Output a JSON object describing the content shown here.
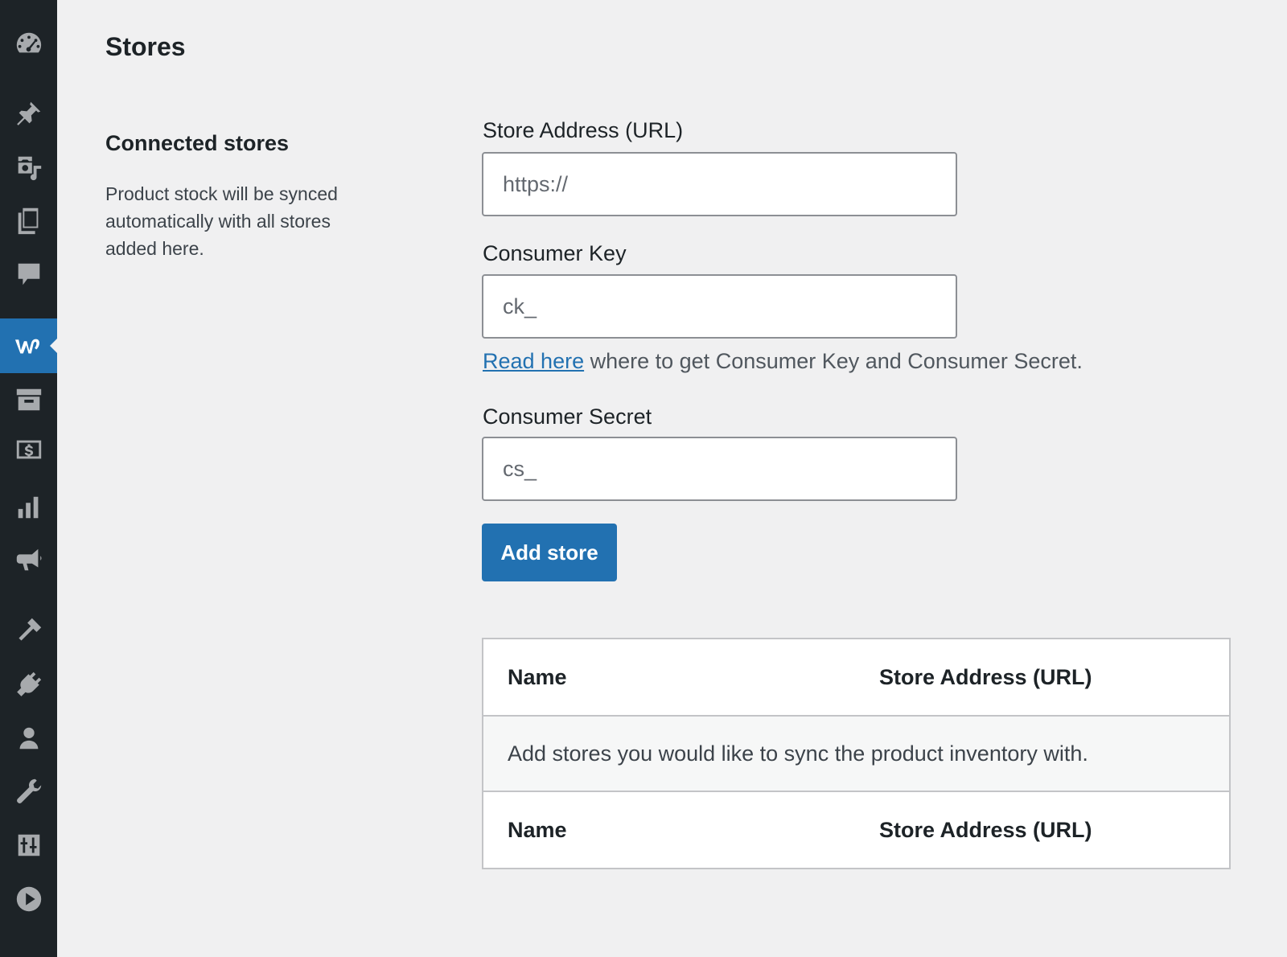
{
  "page": {
    "title": "Stores"
  },
  "sidebar": {
    "icons": [
      "dashboard-icon",
      "pin-icon",
      "media-icon",
      "pages-icon",
      "comments-icon",
      "woocommerce-icon",
      "archive-icon",
      "money-icon",
      "analytics-icon",
      "megaphone-icon",
      "appearance-icon",
      "plugins-icon",
      "users-icon",
      "tools-icon",
      "settings-icon",
      "play-icon"
    ],
    "active": "woocommerce-icon"
  },
  "section": {
    "title": "Connected stores",
    "description": "Product stock will be synced automatically with all stores added here."
  },
  "form": {
    "store_address": {
      "label": "Store Address (URL)",
      "placeholder": "https://",
      "value": ""
    },
    "consumer_key": {
      "label": "Consumer Key",
      "placeholder": "ck_",
      "value": ""
    },
    "help": {
      "link_text": "Read here",
      "text": " where to get Consumer Key and Consumer Secret."
    },
    "consumer_secret": {
      "label": "Consumer Secret",
      "placeholder": "cs_",
      "value": ""
    },
    "submit_label": "Add store"
  },
  "table": {
    "columns": [
      "Name",
      "Store Address (URL)"
    ],
    "empty_message": "Add stores you would like to sync the product inventory with."
  },
  "colors": {
    "accent": "#2271b1",
    "sidebar_bg": "#1d2327",
    "background": "#f0f0f1"
  }
}
